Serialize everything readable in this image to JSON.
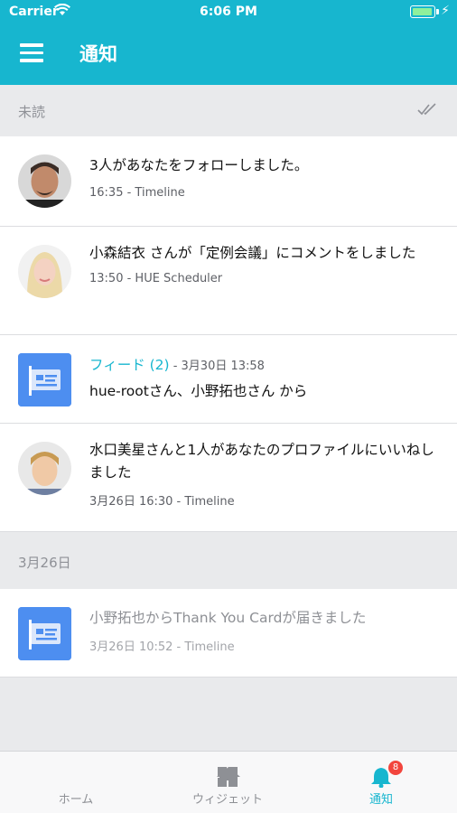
{
  "status_bar": {
    "carrier": "Carrier",
    "time": "6:06 PM"
  },
  "header": {
    "title": "通知",
    "background": "#17b6cf"
  },
  "sections": {
    "unread_label": "未読",
    "date_label": "3月26日"
  },
  "notifications": [
    {
      "message": "3人があなたをフォローしました。",
      "meta": "16:35 - Timeline",
      "icon": "avatar-man"
    },
    {
      "message": "小森結衣 さんが「定例会議」にコメントをしました",
      "meta": "13:50 - HUE Scheduler",
      "icon": "avatar-woman"
    },
    {
      "feed_title": "フィード (2)",
      "feed_date": " - 3月30日 13:58",
      "message": "hue-rootさん、小野拓也さん から",
      "icon": "feed-card-icon"
    },
    {
      "message": "水口美星さんと1人があなたのプロファイルにいいねしました",
      "meta": "3月26日 16:30 - Timeline",
      "icon": "avatar-boy"
    },
    {
      "message": "小野拓也からThank You Cardが届きました",
      "meta": "3月26日 10:52 - Timeline",
      "icon": "feed-card-icon",
      "read": true
    }
  ],
  "tabbar": {
    "home_label": "ホーム",
    "widget_label": "ウィジェット",
    "notifications_label": "通知",
    "badge_count": "8",
    "accent": "#17b6cf",
    "badge_color": "#f2453d"
  }
}
